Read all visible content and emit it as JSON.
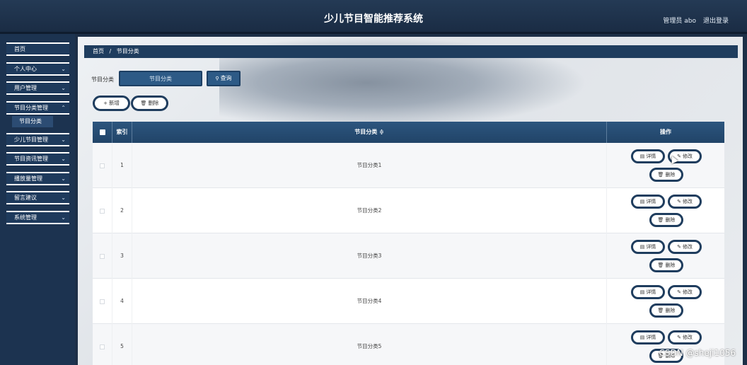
{
  "header": {
    "title": "少儿节目智能推荐系统",
    "admin": "管理员 abo",
    "logout": "退出登录"
  },
  "sidebar": {
    "items": [
      {
        "label": "首页",
        "has_chevron": false
      },
      {
        "label": "个人中心",
        "has_chevron": true
      },
      {
        "label": "用户管理",
        "has_chevron": true
      },
      {
        "label": "节目分类管理",
        "has_chevron": true
      },
      {
        "label": "少儿节目管理",
        "has_chevron": true
      },
      {
        "label": "节目资讯管理",
        "has_chevron": true
      },
      {
        "label": "播放量管理",
        "has_chevron": true
      },
      {
        "label": "留言建议",
        "has_chevron": true
      },
      {
        "label": "系统管理",
        "has_chevron": true
      }
    ],
    "active_sub": "节目分类"
  },
  "breadcrumb": {
    "home": "首页",
    "separator": "/",
    "current": "节目分类"
  },
  "search": {
    "label": "节目分类",
    "placeholder": "节目分类",
    "button": "查询"
  },
  "actions": {
    "add": "新增",
    "delete": "删除"
  },
  "table": {
    "headers": {
      "index": "索引",
      "name": "节目分类 ≑",
      "ops": "操作"
    },
    "rows": [
      {
        "index": "1",
        "name": "节目分类1"
      },
      {
        "index": "2",
        "name": "节目分类2"
      },
      {
        "index": "3",
        "name": "节目分类3"
      },
      {
        "index": "4",
        "name": "节目分类4"
      },
      {
        "index": "5",
        "name": "节目分类5"
      }
    ],
    "row_actions": {
      "detail": "详情",
      "edit": "修改",
      "delete": "删除"
    }
  },
  "icons": {
    "chevron": "chevron-down-icon",
    "search": "search-icon",
    "plus": "plus-icon",
    "trash": "trash-icon",
    "doc": "document-icon",
    "pencil": "pencil-icon"
  },
  "colors": {
    "primary": "#1f3d5e",
    "header_bg": "#1a2c44"
  },
  "watermark": "CSDN @sheji1056"
}
